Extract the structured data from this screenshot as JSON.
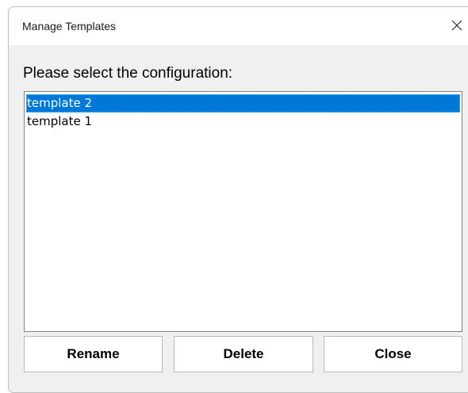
{
  "window": {
    "title": "Manage Templates",
    "close_icon": "close-icon"
  },
  "prompt": "Please select the configuration:",
  "templates": [
    {
      "label": "template 2",
      "selected": true
    },
    {
      "label": "template 1",
      "selected": false
    }
  ],
  "buttons": {
    "rename": "Rename",
    "delete": "Delete",
    "close": "Close"
  },
  "colors": {
    "selection": "#0078d7",
    "dialog_background": "#f0f0f0"
  }
}
